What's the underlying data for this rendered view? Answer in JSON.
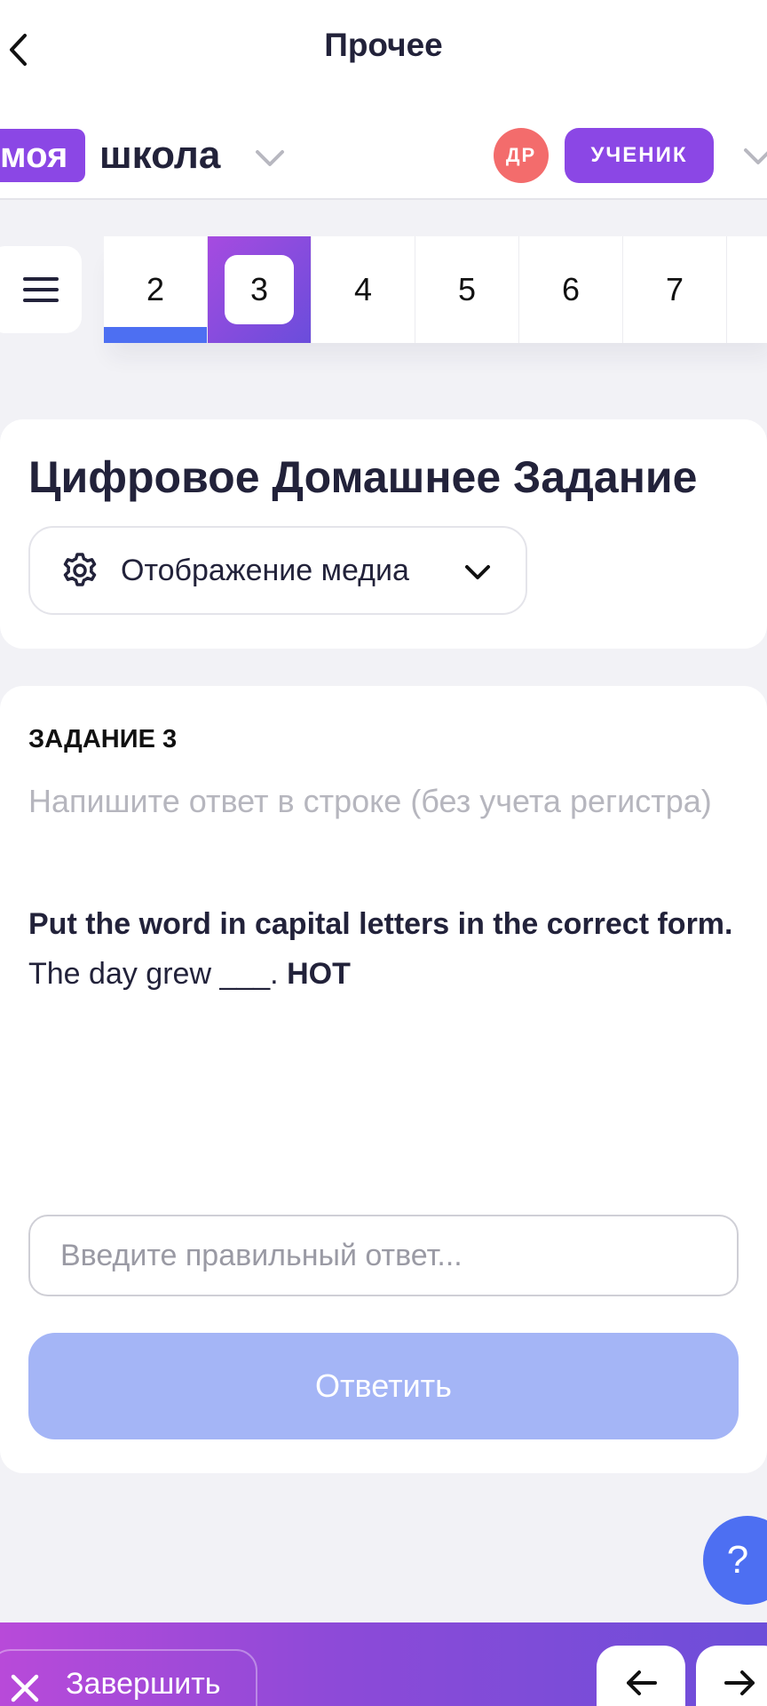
{
  "topnav": {
    "title": "Прочее",
    "back_icon": "chevron-left-icon"
  },
  "header": {
    "logo_part1": "моя",
    "logo_part2": "школа",
    "avatar_initials": "ДР",
    "role": "УЧЕНИК",
    "brand_color": "#8b47e5",
    "avatar_color": "#f36c6c"
  },
  "task_strip": {
    "tasks": [
      {
        "num": "2",
        "state": "done"
      },
      {
        "num": "3",
        "state": "active"
      },
      {
        "num": "4",
        "state": ""
      },
      {
        "num": "5",
        "state": ""
      },
      {
        "num": "6",
        "state": ""
      },
      {
        "num": "7",
        "state": ""
      }
    ],
    "done_color": "#4d6ff2"
  },
  "title_card": {
    "title": "Цифровое Домашнее Задание",
    "media_label": "Отображение медиа"
  },
  "task": {
    "number_label": "ЗАДАНИЕ 3",
    "instruction": "Напишите ответ в строке (без учета регистра)",
    "question_bold": "Put the word in capital letters in the correct form.",
    "question_text": "The day grew ___. ",
    "question_keyword": "HOT",
    "answer_value": "",
    "answer_placeholder": "Введите правильный ответ...",
    "submit_label": "Ответить"
  },
  "help": {
    "label": "?"
  },
  "bottom_bar": {
    "finish_label": "Завершить",
    "prev_icon": "arrow-left-icon",
    "next_icon": "arrow-right-icon"
  }
}
